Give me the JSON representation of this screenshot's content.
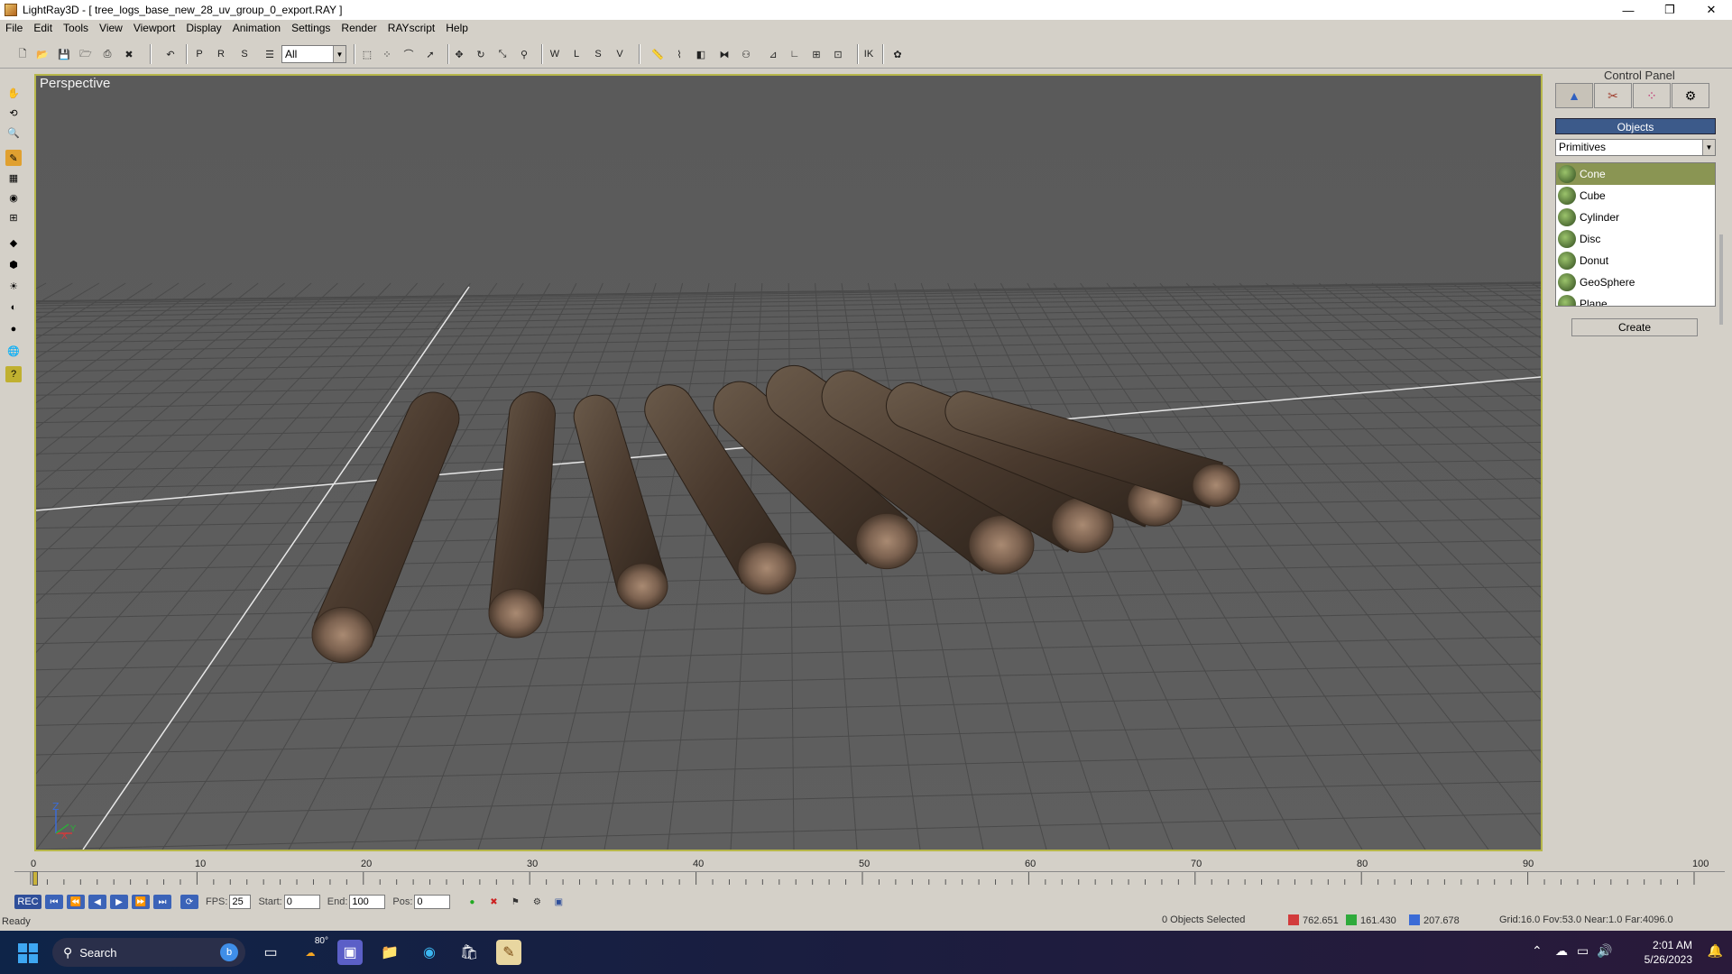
{
  "window": {
    "title": "LightRay3D - [ tree_logs_base_new_28_uv_group_0_export.RAY ]",
    "controls": [
      "—",
      "❐",
      "✕"
    ]
  },
  "menu": [
    "File",
    "Edit",
    "Tools",
    "View",
    "Viewport",
    "Display",
    "Animation",
    "Settings",
    "Render",
    "RAYscript",
    "Help"
  ],
  "toolbar": {
    "filter_value": "All"
  },
  "viewport": {
    "label": "Perspective",
    "axis_labels": [
      "Z",
      "X",
      "Y"
    ]
  },
  "control_panel": {
    "title": "Control Panel",
    "objects_header": "Objects",
    "category": "Primitives",
    "items": [
      "Cone",
      "Cube",
      "Cylinder",
      "Disc",
      "Donut",
      "GeoSphere",
      "Plane"
    ],
    "selected_item": "Cone",
    "create_label": "Create"
  },
  "timeline": {
    "ticks": [
      "0",
      "10",
      "20",
      "30",
      "40",
      "50",
      "60",
      "70",
      "80",
      "90",
      "100"
    ]
  },
  "playback": {
    "rec_label": "REC",
    "fps_label": "FPS:",
    "fps": "25",
    "start_label": "Start:",
    "start": "0",
    "end_label": "End:",
    "end": "100",
    "pos_label": "Pos:",
    "pos": "0"
  },
  "status": {
    "ready": "Ready",
    "objects_selected": "0 Objects Selected",
    "x": "762.651",
    "y": "161.430",
    "z": "207.678",
    "grid_info": "Grid:16.0 Fov:53.0 Near:1.0 Far:4096.0"
  },
  "taskbar": {
    "search_placeholder": "Search",
    "weather": "80°",
    "time": "2:01 AM",
    "date": "5/26/2023"
  },
  "colors": {
    "viewport_bg": "#5e5e5e",
    "viewport_border": "#b7b74a",
    "selection_bg": "#8a9553",
    "objects_header": "#3c5a8a"
  }
}
